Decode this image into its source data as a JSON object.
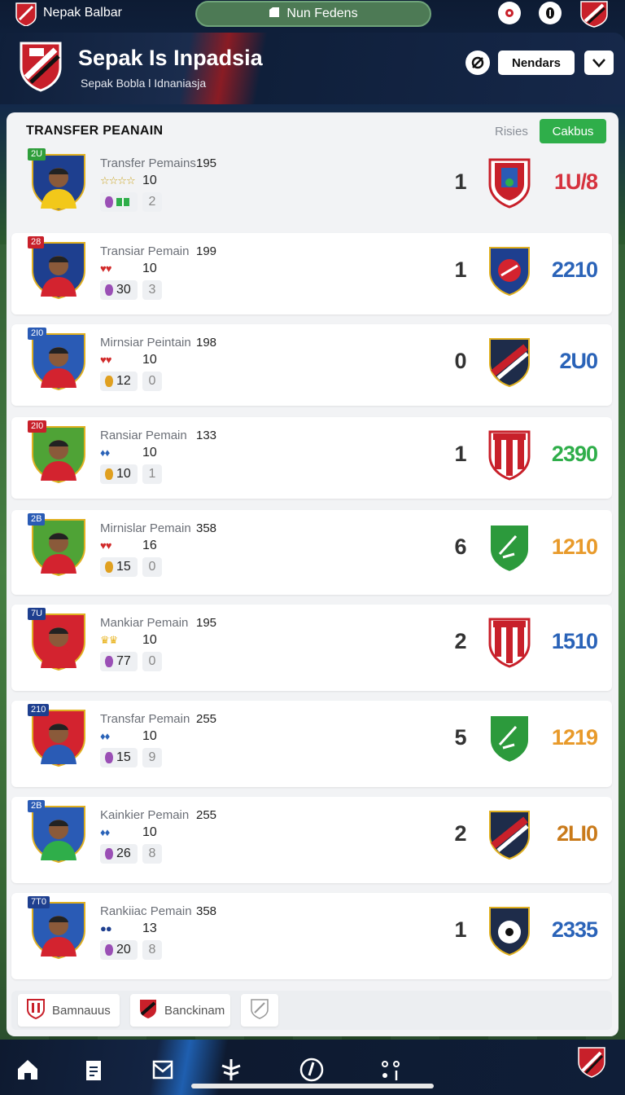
{
  "app": {
    "top_title": "Nepak Balbar",
    "search_label": "Nun Fedens",
    "header_title": "Sepak Is Inpadsia",
    "header_subtitle": "Sepak Bobla l Idnaniasja",
    "header_button": "Nendars"
  },
  "panel": {
    "title": "TRANSFER PEANAIN",
    "link_label": "Risies",
    "action_button": "Cakbus"
  },
  "rows": [
    {
      "tag": "2U",
      "tag_color": "#2f9e3b",
      "name": "Transfer Pemains",
      "num": "195",
      "stars": "☆☆☆☆",
      "stars_color": "#c9a21a",
      "val": "10",
      "chip_a": "",
      "chip_b": "2",
      "score": "1",
      "amount": "1U/8",
      "amount_color": "#d6323e",
      "jersey": "#f2c81a",
      "jersey_bg": "#1e3f8f",
      "club": "red"
    },
    {
      "tag": "28",
      "tag_color": "#c8202a",
      "name": "Transiar Pemain",
      "num": "199",
      "stars": "♥♥",
      "stars_color": "#d12a2a",
      "val": "10",
      "chip_a": "30",
      "chip_b": "3",
      "score": "1",
      "amount": "2210",
      "amount_color": "#2a63b8",
      "jersey": "#d3232f",
      "jersey_bg": "#1e3f8f",
      "club": "blue"
    },
    {
      "tag": "2I0",
      "tag_color": "#2a5bb5",
      "name": "Mirnsiar Peintain",
      "num": "198",
      "stars": "♥♥",
      "stars_color": "#d12a2a",
      "val": "10",
      "chip_a": "12",
      "chip_b": "0",
      "score": "0",
      "amount": "2U0",
      "amount_color": "#2a63b8",
      "jersey": "#d3232f",
      "jersey_bg": "#2a5bb5",
      "club": "navy"
    },
    {
      "tag": "2I0",
      "tag_color": "#c8202a",
      "name": "Ransiar Pemain",
      "num": "133",
      "stars": "♦♦",
      "stars_color": "#2a63b8",
      "val": "10",
      "chip_a": "10",
      "chip_b": "1",
      "score": "1",
      "amount": "2390",
      "amount_color": "#2fae4a",
      "jersey": "#d3232f",
      "jersey_bg": "#4fa336",
      "club": "redstripe"
    },
    {
      "tag": "2B",
      "tag_color": "#2a5bb5",
      "name": "Mirnislar Pemain",
      "num": "358",
      "stars": "♥♥",
      "stars_color": "#d12a2a",
      "val": "16",
      "chip_a": "15",
      "chip_b": "0",
      "score": "6",
      "amount": "1210",
      "amount_color": "#e89a2a",
      "jersey": "#d3232f",
      "jersey_bg": "#4fa336",
      "club": "green"
    },
    {
      "tag": "7U",
      "tag_color": "#1e3f8f",
      "name": "Mankiar Pemain",
      "num": "195",
      "stars": "♛♛",
      "stars_color": "#e8b21a",
      "val": "10",
      "chip_a": "77",
      "chip_b": "0",
      "score": "2",
      "amount": "1510",
      "amount_color": "#2a63b8",
      "jersey": "#d3232f",
      "jersey_bg": "#d3232f",
      "club": "redstripe"
    },
    {
      "tag": "210",
      "tag_color": "#1e3f8f",
      "name": "Transfar Pemain",
      "num": "255",
      "stars": "♦♦",
      "stars_color": "#2a63b8",
      "val": "10",
      "chip_a": "15",
      "chip_b": "9",
      "score": "5",
      "amount": "1219",
      "amount_color": "#e89a2a",
      "jersey": "#2a5bb5",
      "jersey_bg": "#d3232f",
      "club": "green"
    },
    {
      "tag": "2B",
      "tag_color": "#2a5bb5",
      "name": "Kainkier Pemain",
      "num": "255",
      "stars": "♦♦",
      "stars_color": "#2a63b8",
      "val": "10",
      "chip_a": "26",
      "chip_b": "8",
      "score": "2",
      "amount": "2LI0",
      "amount_color": "#c97a1a",
      "jersey": "#2fae4a",
      "jersey_bg": "#2a5bb5",
      "club": "navy"
    },
    {
      "tag": "7T0",
      "tag_color": "#1e3f8f",
      "name": "Rankiiac Pemain",
      "num": "358",
      "stars": "●●",
      "stars_color": "#1e3f8f",
      "val": "13",
      "chip_a": "20",
      "chip_b": "8",
      "score": "1",
      "amount": "2335",
      "amount_color": "#2a63b8",
      "jersey": "#d3232f",
      "jersey_bg": "#2a5bb5",
      "club": "ball"
    }
  ],
  "bottom_chips": [
    {
      "label": "Bamnauus"
    },
    {
      "label": "Banckinam"
    },
    {
      "label": ""
    }
  ],
  "tabs": [
    "home-icon",
    "clipboard-icon",
    "mail-icon",
    "trophy-icon",
    "stats-icon",
    "more-icon"
  ]
}
